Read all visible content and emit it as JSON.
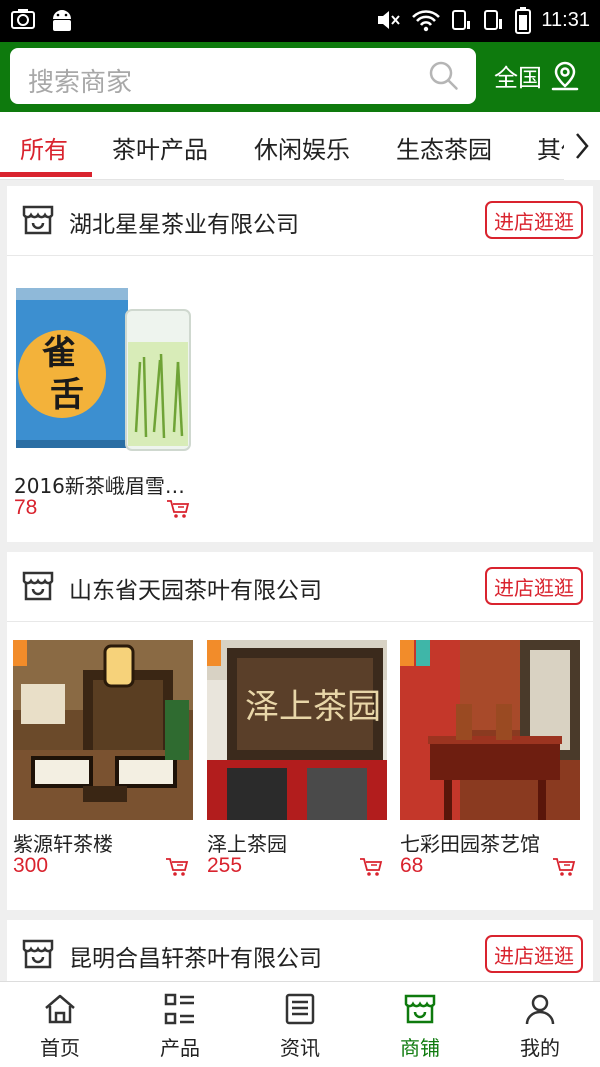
{
  "status_bar": {
    "time": "11:31"
  },
  "header": {
    "search_placeholder": "搜索商家",
    "region_label": "全国"
  },
  "tabs": [
    {
      "label": "所有",
      "active": true
    },
    {
      "label": "茶叶产品",
      "active": false
    },
    {
      "label": "休闲娱乐",
      "active": false
    },
    {
      "label": "生态茶园",
      "active": false
    },
    {
      "label": "其他",
      "active": false
    }
  ],
  "stores": [
    {
      "name": "湖北星星茶业有限公司",
      "visit_label": "进店逛逛",
      "products": [
        {
          "name": "2016新茶峨眉雪…",
          "price": "78"
        }
      ]
    },
    {
      "name": "山东省天园茶叶有限公司",
      "visit_label": "进店逛逛",
      "products": [
        {
          "name": "紫源轩茶楼",
          "price": "300"
        },
        {
          "name": "泽上茶园",
          "price": "255"
        },
        {
          "name": "七彩田园茶艺馆",
          "price": "68"
        }
      ]
    },
    {
      "name": "昆明合昌轩茶叶有限公司",
      "visit_label": "进店逛逛",
      "products": []
    }
  ],
  "product_image_text": {
    "tea_can": "雀舌",
    "sign": "泽上茶园"
  },
  "bottom_nav": [
    {
      "label": "首页",
      "icon": "home-icon",
      "active": false
    },
    {
      "label": "产品",
      "icon": "list-icon",
      "active": false
    },
    {
      "label": "资讯",
      "icon": "news-icon",
      "active": false
    },
    {
      "label": "商铺",
      "icon": "shop-icon",
      "active": true
    },
    {
      "label": "我的",
      "icon": "user-icon",
      "active": false
    }
  ],
  "colors": {
    "brand_green": "#0e7a0d",
    "accent_red": "#d9232e"
  }
}
